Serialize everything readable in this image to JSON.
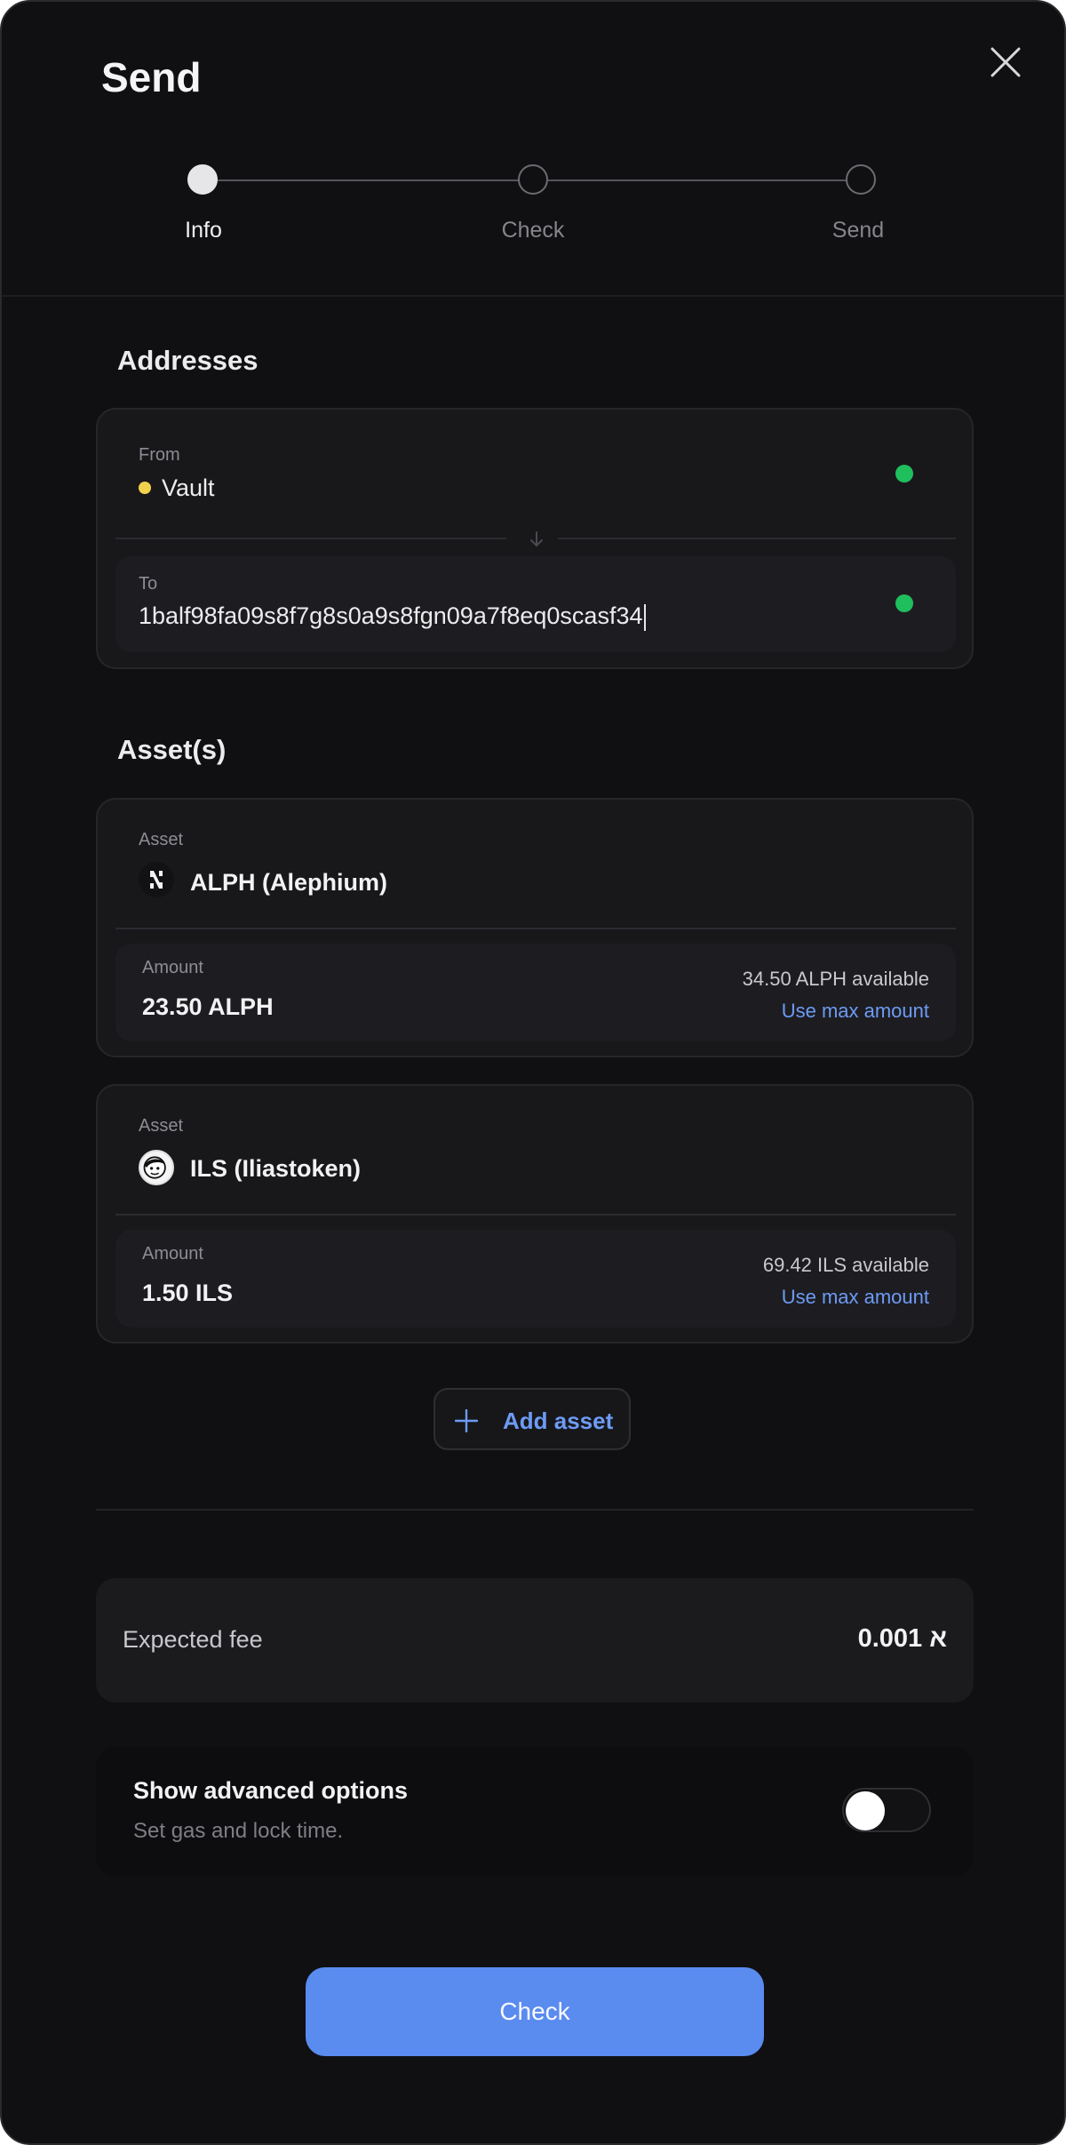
{
  "header": {
    "title": "Send"
  },
  "steps": [
    {
      "label": "Info",
      "active": true
    },
    {
      "label": "Check",
      "active": false
    },
    {
      "label": "Send",
      "active": false
    }
  ],
  "addresses": {
    "section_title": "Addresses",
    "from_label": "From",
    "from_value": "Vault",
    "to_label": "To",
    "to_value": "1balf98fa09s8f7g8s0a9s8fgn09a7f8eq0scasf34"
  },
  "assets": {
    "section_title": "Asset(s)",
    "items": [
      {
        "asset_label": "Asset",
        "name": "ALPH (Alephium)",
        "icon": "alephium-logo-icon",
        "amount_label": "Amount",
        "amount": "23.50 ALPH",
        "available": "34.50 ALPH available",
        "use_max": "Use max amount"
      },
      {
        "asset_label": "Asset",
        "name": "ILS (Iliastoken)",
        "icon": "iliastoken-avatar-icon",
        "amount_label": "Amount",
        "amount": "1.50 ILS",
        "available": "69.42 ILS available",
        "use_max": "Use max amount"
      }
    ],
    "add_label": "Add asset"
  },
  "fee": {
    "label": "Expected fee",
    "value": "0.001 א"
  },
  "advanced": {
    "title": "Show advanced options",
    "subtitle": "Set gas and lock time.",
    "enabled": false
  },
  "primary_button": {
    "label": "Check"
  },
  "colors": {
    "accent": "#5a8bef",
    "link": "#6d9bf5",
    "success": "#1fbf5e",
    "vault_dot": "#f2d24d"
  }
}
